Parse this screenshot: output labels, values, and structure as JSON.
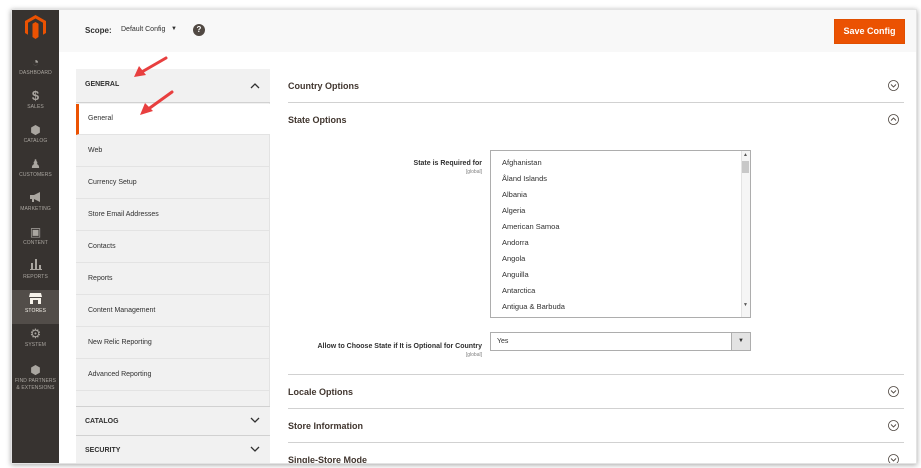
{
  "admin_menu": {
    "logo_icon": "magento-logo-icon",
    "items": [
      {
        "label": "DASHBOARD",
        "icon": "dashboard-icon",
        "glyph": "◔"
      },
      {
        "label": "SALES",
        "icon": "dollar-icon",
        "glyph": "$"
      },
      {
        "label": "CATALOG",
        "icon": "box-icon",
        "glyph": "⬢"
      },
      {
        "label": "CUSTOMERS",
        "icon": "person-icon",
        "glyph": "♟"
      },
      {
        "label": "MARKETING",
        "icon": "megaphone-icon",
        "glyph": "📢"
      },
      {
        "label": "CONTENT",
        "icon": "content-icon",
        "glyph": "▣"
      },
      {
        "label": "REPORTS",
        "icon": "bar-chart-icon",
        "glyph": "▮"
      },
      {
        "label": "STORES",
        "icon": "store-icon",
        "glyph": "⌂"
      },
      {
        "label": "SYSTEM",
        "icon": "gear-icon",
        "glyph": "⚙"
      },
      {
        "label": "FIND PARTNERS",
        "label2": "& EXTENSIONS",
        "icon": "extensions-icon",
        "glyph": "⬢"
      }
    ],
    "active_index": 7,
    "colors": {
      "bg": "#373330",
      "active_bg": "#524d49"
    }
  },
  "header": {
    "scope_label": "Scope:",
    "scope_value": "Default Config",
    "help_icon": "question-icon",
    "help_glyph": "?",
    "save_label": "Save Config",
    "accent": "#eb5202"
  },
  "tabs": {
    "general_title": "GENERAL",
    "general_items": [
      "General",
      "Web",
      "Currency Setup",
      "Store Email Addresses",
      "Contacts",
      "Reports",
      "Content Management",
      "New Relic Reporting",
      "Advanced Reporting"
    ],
    "active_item": "General",
    "catalog_title": "CATALOG",
    "security_title": "SECURITY"
  },
  "main": {
    "sections": {
      "country": "Country Options",
      "state": "State Options",
      "locale": "Locale Options",
      "store_info": "Store Information",
      "single_store": "Single-Store Mode"
    },
    "state_required": {
      "label": "State is Required for",
      "scope": "[global]",
      "options": [
        "Afghanistan",
        "Åland Islands",
        "Albania",
        "Algeria",
        "American Samoa",
        "Andorra",
        "Angola",
        "Anguilla",
        "Antarctica",
        "Antigua & Barbuda"
      ]
    },
    "allow_optional": {
      "label": "Allow to Choose State if It is Optional for Country",
      "scope": "[global]",
      "value": "Yes"
    }
  },
  "annotation_arrow_color": "#e83f3f"
}
